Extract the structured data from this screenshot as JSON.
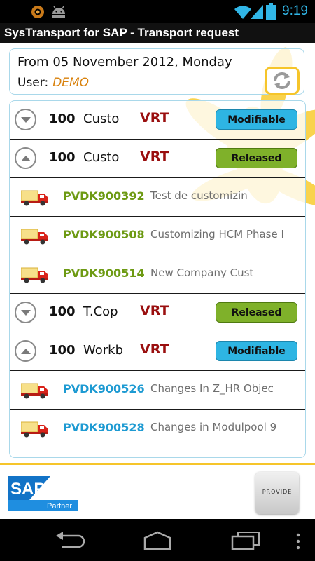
{
  "status_bar": {
    "time": "9:19",
    "icons": [
      "notification-circle-icon",
      "android-icon",
      "wifi-icon",
      "signal-icon",
      "battery-icon"
    ]
  },
  "app": {
    "title": "SysTransport for SAP - Transport request"
  },
  "header": {
    "date_text": "From 05 November 2012, Monday",
    "user_label": "User:",
    "user_value": "DEMO",
    "refresh_icon": "refresh-icon"
  },
  "colors": {
    "accent_yellow": "#f6c52a",
    "modifiable_blue": "#2eb5e3",
    "released_green": "#7fb12a",
    "type_red": "#9a0f0f",
    "object_green": "#6d9a13",
    "object_blue": "#1d9ad2"
  },
  "requests": [
    {
      "number": "100",
      "description": "Custo",
      "type": "VRT",
      "status": "Modifiable",
      "expanded": false
    },
    {
      "number": "100",
      "description": "Custo",
      "type": "VRT",
      "status": "Released",
      "expanded": true,
      "objects": [
        {
          "id": "PVDK900392",
          "description": "Test de customizin"
        },
        {
          "id": "PVDK900508",
          "description": "Customizing HCM Phase I"
        },
        {
          "id": "PVDK900514",
          "description": "New Company Cust"
        }
      ]
    },
    {
      "number": "100",
      "description": "T.Cop",
      "type": "VRT",
      "status": "Released",
      "expanded": false
    },
    {
      "number": "100",
      "description": "Workb",
      "type": "VRT",
      "status": "Modifiable",
      "expanded": true,
      "objects": [
        {
          "id": "PVDK900526",
          "description": "Changes In Z_HR Objec"
        },
        {
          "id": "PVDK900528",
          "description": "Changes in Modulpool 9"
        }
      ]
    }
  ],
  "footer": {
    "sap_logo_text": "SAP",
    "sap_partner_text": "Partner",
    "provide_logo_text": "PROVIDE"
  },
  "nav_bar": {
    "icons": [
      "back-icon",
      "home-icon",
      "recent-apps-icon",
      "menu-icon"
    ]
  }
}
